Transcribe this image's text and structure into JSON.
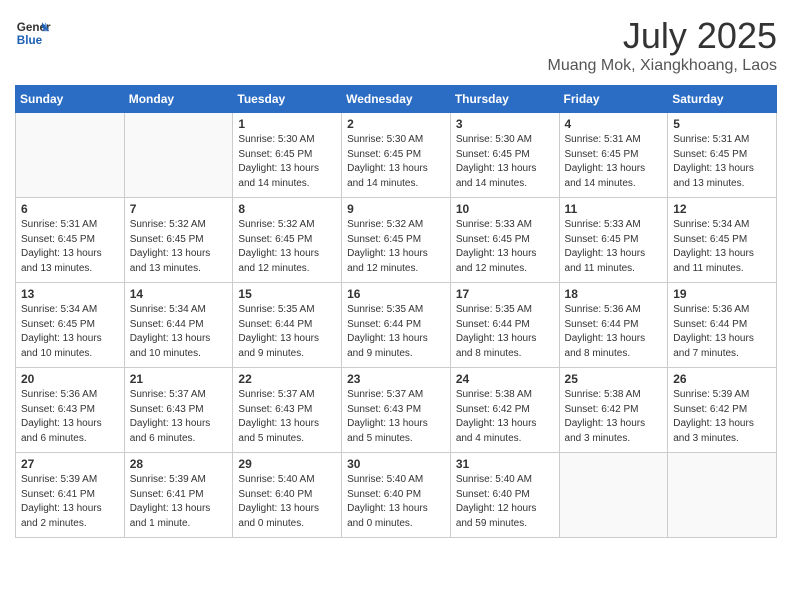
{
  "header": {
    "logo_line1": "General",
    "logo_line2": "Blue",
    "month": "July 2025",
    "location": "Muang Mok, Xiangkhoang, Laos"
  },
  "weekdays": [
    "Sunday",
    "Monday",
    "Tuesday",
    "Wednesday",
    "Thursday",
    "Friday",
    "Saturday"
  ],
  "weeks": [
    [
      {
        "day": "",
        "info": ""
      },
      {
        "day": "",
        "info": ""
      },
      {
        "day": "1",
        "info": "Sunrise: 5:30 AM\nSunset: 6:45 PM\nDaylight: 13 hours\nand 14 minutes."
      },
      {
        "day": "2",
        "info": "Sunrise: 5:30 AM\nSunset: 6:45 PM\nDaylight: 13 hours\nand 14 minutes."
      },
      {
        "day": "3",
        "info": "Sunrise: 5:30 AM\nSunset: 6:45 PM\nDaylight: 13 hours\nand 14 minutes."
      },
      {
        "day": "4",
        "info": "Sunrise: 5:31 AM\nSunset: 6:45 PM\nDaylight: 13 hours\nand 14 minutes."
      },
      {
        "day": "5",
        "info": "Sunrise: 5:31 AM\nSunset: 6:45 PM\nDaylight: 13 hours\nand 13 minutes."
      }
    ],
    [
      {
        "day": "6",
        "info": "Sunrise: 5:31 AM\nSunset: 6:45 PM\nDaylight: 13 hours\nand 13 minutes."
      },
      {
        "day": "7",
        "info": "Sunrise: 5:32 AM\nSunset: 6:45 PM\nDaylight: 13 hours\nand 13 minutes."
      },
      {
        "day": "8",
        "info": "Sunrise: 5:32 AM\nSunset: 6:45 PM\nDaylight: 13 hours\nand 12 minutes."
      },
      {
        "day": "9",
        "info": "Sunrise: 5:32 AM\nSunset: 6:45 PM\nDaylight: 13 hours\nand 12 minutes."
      },
      {
        "day": "10",
        "info": "Sunrise: 5:33 AM\nSunset: 6:45 PM\nDaylight: 13 hours\nand 12 minutes."
      },
      {
        "day": "11",
        "info": "Sunrise: 5:33 AM\nSunset: 6:45 PM\nDaylight: 13 hours\nand 11 minutes."
      },
      {
        "day": "12",
        "info": "Sunrise: 5:34 AM\nSunset: 6:45 PM\nDaylight: 13 hours\nand 11 minutes."
      }
    ],
    [
      {
        "day": "13",
        "info": "Sunrise: 5:34 AM\nSunset: 6:45 PM\nDaylight: 13 hours\nand 10 minutes."
      },
      {
        "day": "14",
        "info": "Sunrise: 5:34 AM\nSunset: 6:44 PM\nDaylight: 13 hours\nand 10 minutes."
      },
      {
        "day": "15",
        "info": "Sunrise: 5:35 AM\nSunset: 6:44 PM\nDaylight: 13 hours\nand 9 minutes."
      },
      {
        "day": "16",
        "info": "Sunrise: 5:35 AM\nSunset: 6:44 PM\nDaylight: 13 hours\nand 9 minutes."
      },
      {
        "day": "17",
        "info": "Sunrise: 5:35 AM\nSunset: 6:44 PM\nDaylight: 13 hours\nand 8 minutes."
      },
      {
        "day": "18",
        "info": "Sunrise: 5:36 AM\nSunset: 6:44 PM\nDaylight: 13 hours\nand 8 minutes."
      },
      {
        "day": "19",
        "info": "Sunrise: 5:36 AM\nSunset: 6:44 PM\nDaylight: 13 hours\nand 7 minutes."
      }
    ],
    [
      {
        "day": "20",
        "info": "Sunrise: 5:36 AM\nSunset: 6:43 PM\nDaylight: 13 hours\nand 6 minutes."
      },
      {
        "day": "21",
        "info": "Sunrise: 5:37 AM\nSunset: 6:43 PM\nDaylight: 13 hours\nand 6 minutes."
      },
      {
        "day": "22",
        "info": "Sunrise: 5:37 AM\nSunset: 6:43 PM\nDaylight: 13 hours\nand 5 minutes."
      },
      {
        "day": "23",
        "info": "Sunrise: 5:37 AM\nSunset: 6:43 PM\nDaylight: 13 hours\nand 5 minutes."
      },
      {
        "day": "24",
        "info": "Sunrise: 5:38 AM\nSunset: 6:42 PM\nDaylight: 13 hours\nand 4 minutes."
      },
      {
        "day": "25",
        "info": "Sunrise: 5:38 AM\nSunset: 6:42 PM\nDaylight: 13 hours\nand 3 minutes."
      },
      {
        "day": "26",
        "info": "Sunrise: 5:39 AM\nSunset: 6:42 PM\nDaylight: 13 hours\nand 3 minutes."
      }
    ],
    [
      {
        "day": "27",
        "info": "Sunrise: 5:39 AM\nSunset: 6:41 PM\nDaylight: 13 hours\nand 2 minutes."
      },
      {
        "day": "28",
        "info": "Sunrise: 5:39 AM\nSunset: 6:41 PM\nDaylight: 13 hours\nand 1 minute."
      },
      {
        "day": "29",
        "info": "Sunrise: 5:40 AM\nSunset: 6:40 PM\nDaylight: 13 hours\nand 0 minutes."
      },
      {
        "day": "30",
        "info": "Sunrise: 5:40 AM\nSunset: 6:40 PM\nDaylight: 13 hours\nand 0 minutes."
      },
      {
        "day": "31",
        "info": "Sunrise: 5:40 AM\nSunset: 6:40 PM\nDaylight: 12 hours\nand 59 minutes."
      },
      {
        "day": "",
        "info": ""
      },
      {
        "day": "",
        "info": ""
      }
    ]
  ]
}
